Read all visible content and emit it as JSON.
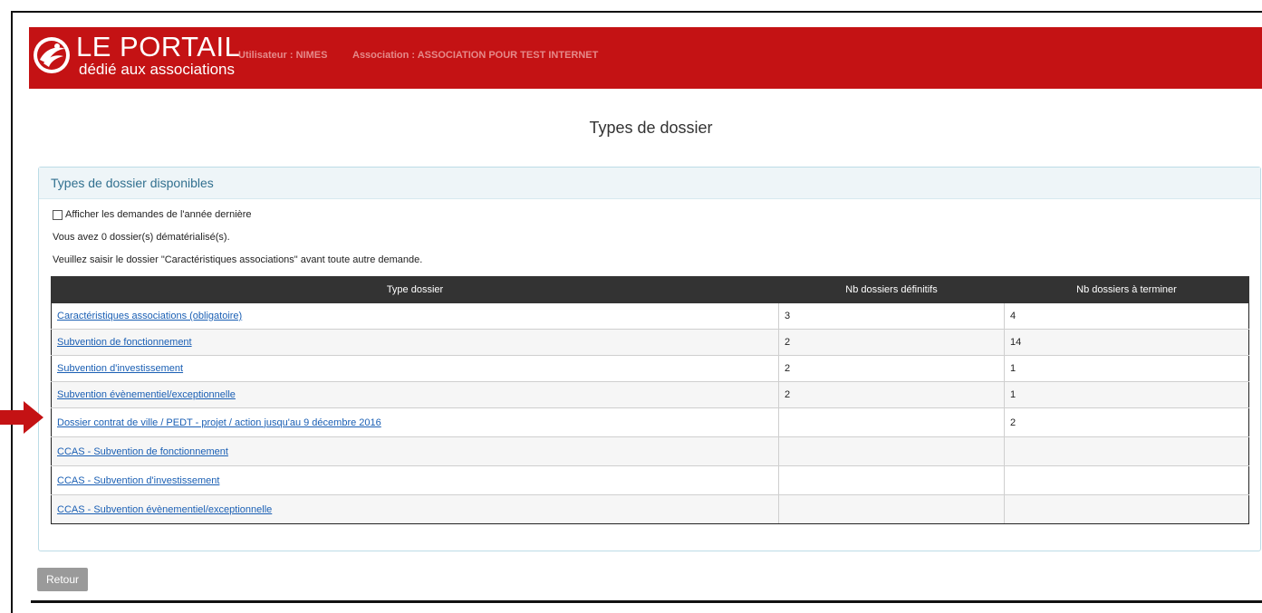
{
  "header": {
    "logo_title": "LE PORTAIL",
    "logo_subtitle": "dédié aux associations",
    "user_info": "Utilisateur : NIMES",
    "association_info": "Association : ASSOCIATION POUR TEST INTERNET",
    "brand_color": "#c41214"
  },
  "page": {
    "title": "Types de dossier"
  },
  "panel": {
    "heading": "Types de dossier disponibles",
    "checkbox_label": "Afficher les demandes de l'année dernière",
    "checkbox_checked": false,
    "info_count": "Vous avez 0 dossier(s) dématérialisé(s).",
    "info_notice": "Veuillez saisir le dossier \"Caractéristiques associations\" avant toute autre demande."
  },
  "table": {
    "columns": [
      "Type dossier",
      "Nb dossiers définitifs",
      "Nb dossiers à terminer"
    ],
    "rows": [
      {
        "type": "Caractéristiques associations (obligatoire)",
        "definitifs": "3",
        "a_terminer": "4"
      },
      {
        "type": "Subvention de fonctionnement",
        "definitifs": "2",
        "a_terminer": "14"
      },
      {
        "type": "Subvention d'investissement",
        "definitifs": "2",
        "a_terminer": "1"
      },
      {
        "type": "Subvention évènementiel/exceptionnelle",
        "definitifs": "2",
        "a_terminer": "1"
      },
      {
        "type": "Dossier contrat de ville / PEDT - projet / action jusqu'au 9 décembre 2016",
        "definitifs": "",
        "a_terminer": "2"
      },
      {
        "type": "CCAS - Subvention de fonctionnement",
        "definitifs": "",
        "a_terminer": ""
      },
      {
        "type": "CCAS - Subvention d'investissement",
        "definitifs": "",
        "a_terminer": ""
      },
      {
        "type": "CCAS - Subvention évènementiel/exceptionnelle",
        "definitifs": "",
        "a_terminer": ""
      }
    ]
  },
  "annotation": {
    "arrow_icon": "red-right-arrow-icon",
    "arrow_color": "#c41214"
  },
  "footer": {
    "back_label": "Retour"
  }
}
